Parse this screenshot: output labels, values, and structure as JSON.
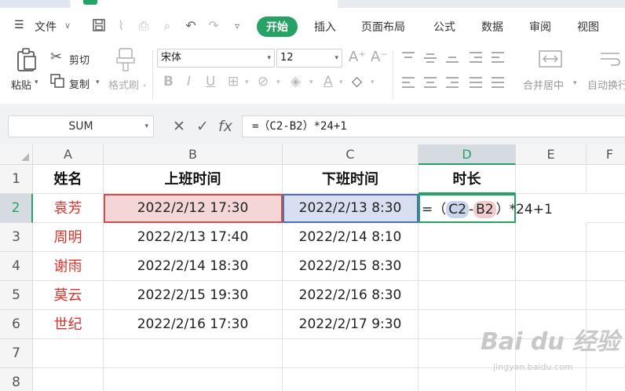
{
  "menu": {
    "file": "文件",
    "tabs": [
      "开始",
      "插入",
      "页面布局",
      "公式",
      "数据",
      "审阅",
      "视图"
    ]
  },
  "ribbon": {
    "paste": "粘贴",
    "cut": "剪切",
    "copy": "复制",
    "format_painter": "格式刷",
    "font_name": "宋体",
    "font_size": "12",
    "merge_center": "合并居中",
    "auto_wrap": "自动换行"
  },
  "formula_bar": {
    "name_box": "SUM",
    "formula": "=（C2-B2）*24+1"
  },
  "columns": [
    "A",
    "B",
    "C",
    "D",
    "E",
    "F"
  ],
  "rows": [
    "1",
    "2",
    "3",
    "4",
    "5",
    "6",
    "7",
    "8"
  ],
  "headers": [
    "姓名",
    "上班时间",
    "下班时间",
    "时长"
  ],
  "data": [
    {
      "name": "袁芳",
      "start": "2022/2/12 17:30",
      "end": "2022/2/13 8:30"
    },
    {
      "name": "周明",
      "start": "2022/2/13 17:40",
      "end": "2022/2/14 8:10"
    },
    {
      "name": "谢雨",
      "start": "2022/2/14 18:30",
      "end": "2022/2/15 8:30"
    },
    {
      "name": "莫云",
      "start": "2022/2/15 19:30",
      "end": "2022/2/16 8:30"
    },
    {
      "name": "世纪",
      "start": "2022/2/16 17:30",
      "end": "2022/2/17 9:30"
    }
  ],
  "editing_cell": {
    "prefix": "=（",
    "ref1": "C2",
    "op": "-",
    "ref2": "B2",
    "suffix": "）*24+1"
  },
  "watermark": {
    "main": "Bai du 经验",
    "sub": "jingyan.baidu.com"
  },
  "colors": {
    "accent": "#27a265",
    "ref_b": "#c9504b",
    "ref_c": "#4b6fb8",
    "name_text": "#d6322d"
  }
}
